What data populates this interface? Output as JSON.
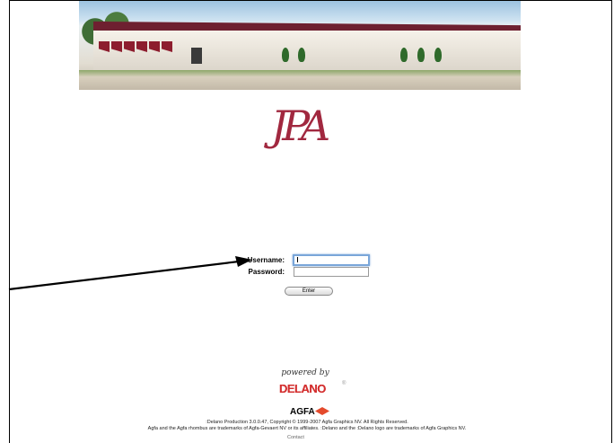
{
  "login": {
    "username_label": "Username:",
    "password_label": "Password:",
    "username_value": "",
    "password_value": "",
    "enter_label": "Enter"
  },
  "footer": {
    "powered_by": "powered by",
    "delano_brand": "DELANO",
    "agfa_brand": "AGFA",
    "copyright_line": ":Delano Production 3.0.0.47, Copyright © 1999-2007 Agfa Graphics NV. All Rights Reserved.",
    "trademark_line": "Agfa and the Agfa rhombus are trademarks of Agfa-Gevaert NV or its affiliates. :Delano and the :Delano logo are trademarks of Agfa Graphics NV.",
    "contact_label": "Contact"
  },
  "colors": {
    "logo": "#a1283f",
    "delano": "#d32f2f",
    "agfa_rhombus": "#e44a2c",
    "focus_ring": "#7aa6d9"
  },
  "icons": {
    "pointer_arrow": "arrow-pointing-to-username-field",
    "registered_mark": "®"
  }
}
